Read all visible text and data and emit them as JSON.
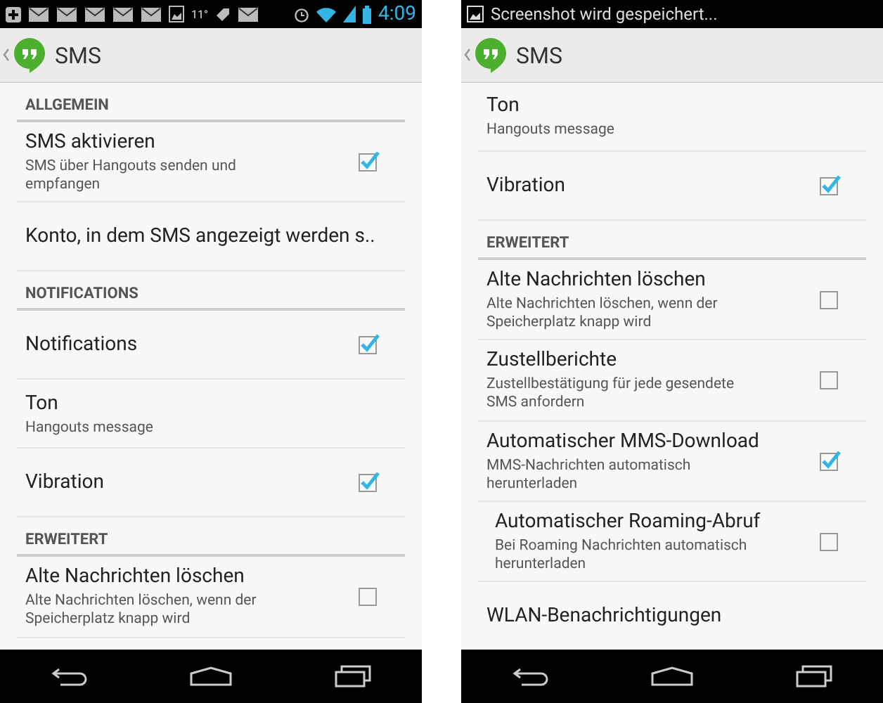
{
  "screens": [
    {
      "status_bar": {
        "kind": "icons",
        "temperature": "11°",
        "time": "4:09"
      },
      "action_bar": {
        "title": "SMS"
      },
      "items": [
        {
          "kind": "header",
          "label": "ALLGEMEIN"
        },
        {
          "kind": "setting",
          "title": "SMS aktivieren",
          "summary": "SMS über Hangouts senden und empfangen",
          "checked": true
        },
        {
          "kind": "setting",
          "title": "Konto, in dem SMS angezeigt werden s.."
        },
        {
          "kind": "header",
          "label": "NOTIFICATIONS"
        },
        {
          "kind": "setting",
          "title": "Notifications",
          "checked": true
        },
        {
          "kind": "setting",
          "title": "Ton",
          "summary": "Hangouts message"
        },
        {
          "kind": "setting",
          "title": "Vibration",
          "checked": true
        },
        {
          "kind": "header",
          "label": "ERWEITERT"
        },
        {
          "kind": "setting",
          "title": "Alte Nachrichten löschen",
          "summary": "Alte Nachrichten löschen, wenn der Speicherplatz knapp wird",
          "checked": false
        }
      ]
    },
    {
      "status_bar": {
        "kind": "notice",
        "text": "Screenshot wird gespeichert..."
      },
      "action_bar": {
        "title": "SMS"
      },
      "items": [
        {
          "kind": "setting",
          "title": "Ton",
          "summary": "Hangouts message"
        },
        {
          "kind": "setting",
          "title": "Vibration",
          "checked": true
        },
        {
          "kind": "header",
          "label": "ERWEITERT"
        },
        {
          "kind": "setting",
          "title": "Alte Nachrichten löschen",
          "summary": "Alte Nachrichten löschen, wenn der Speicherplatz knapp wird",
          "checked": false
        },
        {
          "kind": "setting",
          "title": "Zustellberichte",
          "summary": "Zustellbestätigung für jede gesendete SMS anfordern",
          "checked": false
        },
        {
          "kind": "setting",
          "title": "Automatischer MMS-Download",
          "summary": "MMS-Nachrichten automatisch herunterladen",
          "checked": true,
          "children": [
            {
              "kind": "setting",
              "title": "Automatischer Roaming-Abruf",
              "summary": "Bei Roaming Nachrichten automatisch herunterladen",
              "checked": false
            }
          ]
        },
        {
          "kind": "setting",
          "title": "WLAN-Benachrichtigungen"
        }
      ]
    }
  ]
}
